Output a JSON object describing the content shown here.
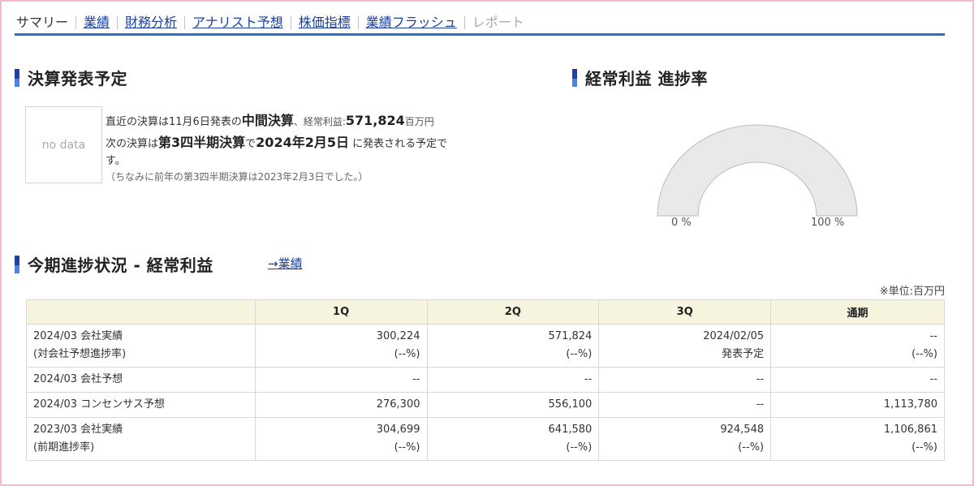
{
  "tabs": [
    {
      "label": "サマリー",
      "state": "current"
    },
    {
      "label": "業績",
      "state": "link"
    },
    {
      "label": "財務分析",
      "state": "link"
    },
    {
      "label": "アナリスト予想",
      "state": "link"
    },
    {
      "label": "株価指標",
      "state": "link"
    },
    {
      "label": "業績フラッシュ",
      "state": "link"
    },
    {
      "label": "レポート",
      "state": "disabled"
    }
  ],
  "decision": {
    "heading": "決算発表予定",
    "no_data": "no data",
    "l1_a": "直近の決算は11月6日発表の",
    "l1_b": "中間決算",
    "l1_c": "、経常利益:",
    "l1_d": "571,824",
    "l1_e": "百万円",
    "l2_a": "次の決算は",
    "l2_b": "第3四半期決算",
    "l2_c": "で",
    "l2_d": "2024年2月5日",
    "l2_e": " に発表される予定で",
    "l3": "す。",
    "note": "（ちなみに前年の第3四半期決算は2023年2月3日でした。）"
  },
  "gauge": {
    "heading": "経常利益 進捗率",
    "min_label": "0 %",
    "max_label": "100 %",
    "track_color": "#e9e9e9",
    "value_percent": 0
  },
  "progress": {
    "heading": "今期進捗状況 - 経常利益",
    "link_label": "→業績",
    "unit": "※単位:百万円",
    "columns": [
      "",
      "1Q",
      "2Q",
      "3Q",
      "通期"
    ],
    "rows": [
      {
        "label": [
          "2024/03 会社実績",
          "(対会社予想進捗率)"
        ],
        "cells": [
          [
            "300,224",
            "(--%)"
          ],
          [
            "571,824",
            "(--%)"
          ],
          [
            "2024/02/05",
            "発表予定"
          ],
          [
            "--",
            "(--%)"
          ]
        ]
      },
      {
        "label": [
          "2024/03 会社予想"
        ],
        "cells": [
          [
            "--"
          ],
          [
            "--"
          ],
          [
            "--"
          ],
          [
            "--"
          ]
        ]
      },
      {
        "label": [
          "2024/03 コンセンサス予想"
        ],
        "cells": [
          [
            "276,300"
          ],
          [
            "556,100"
          ],
          [
            "--"
          ],
          [
            "1,113,780"
          ]
        ]
      },
      {
        "label": [
          "2023/03 会社実績",
          "(前期進捗率)"
        ],
        "cells": [
          [
            "304,699",
            "(--%)"
          ],
          [
            "641,580",
            "(--%)"
          ],
          [
            "924,548",
            "(--%)"
          ],
          [
            "1,106,861",
            "(--%)"
          ]
        ]
      }
    ]
  }
}
